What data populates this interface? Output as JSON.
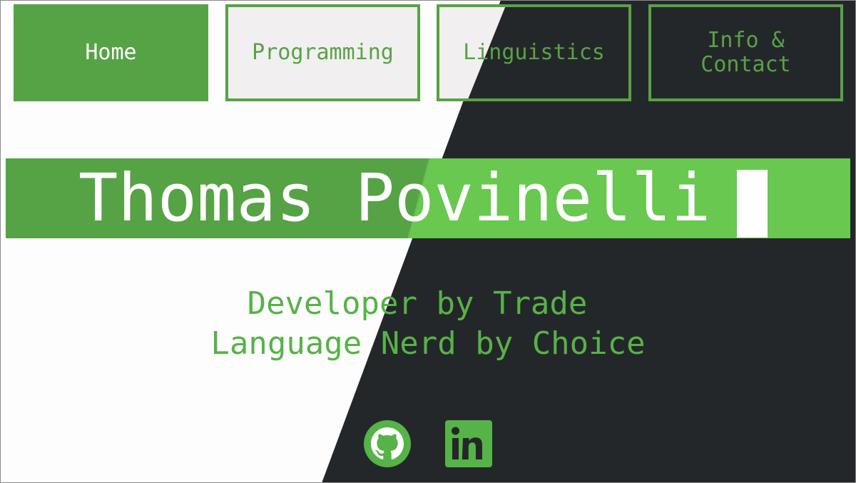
{
  "nav": {
    "items": [
      {
        "label": "Home",
        "active": true
      },
      {
        "label": "Programming",
        "active": false
      },
      {
        "label": "Linguistics",
        "active": false
      },
      {
        "label": "Info &\nContact",
        "active": false
      }
    ]
  },
  "hero": {
    "name": "Thomas Povinelli",
    "tagline_line1": "Developer by Trade",
    "tagline_line2": "Language Nerd by Choice"
  },
  "social": {
    "icons": [
      "github-icon",
      "linkedin-icon"
    ]
  },
  "colors": {
    "accent_green": "#56a345",
    "bright_green": "#68c84f",
    "dark_bg": "#24272a",
    "light_bg": "#fdfdfd",
    "nav_light_bg": "#f2eff0"
  }
}
